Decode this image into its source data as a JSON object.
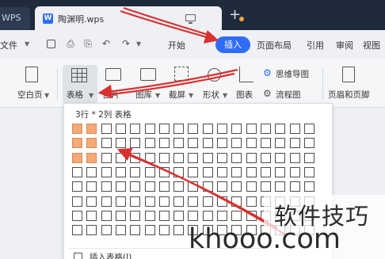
{
  "tabs": {
    "app_tab": "WPS",
    "doc_tab": "陶渊明.wps"
  },
  "menubar": {
    "file": "文件",
    "items": [
      "开始",
      "插入",
      "页面布局",
      "引用",
      "审阅",
      "视图"
    ],
    "active": "插入"
  },
  "ribbon": {
    "blank_page": "空白页",
    "table": "表格",
    "picture": "图片",
    "gallery": "图库",
    "screenshot": "截屏",
    "shapes": "形状",
    "chart": "图表",
    "mind_map": "思维导图",
    "flowchart": "流程图",
    "header_footer": "页眉和页脚"
  },
  "table_dropdown": {
    "header": "3行 * 2列 表格",
    "rows_selected": 3,
    "cols_selected": 2,
    "insert_table": "插入表格(I)"
  },
  "watermark": {
    "line1": "软件技巧",
    "line2": "khooo.com"
  },
  "colors": {
    "accent": "#2f6df6",
    "selected_cell": "#f4a977",
    "arrow": "#d93030",
    "titlebar": "#1f2a3a"
  }
}
